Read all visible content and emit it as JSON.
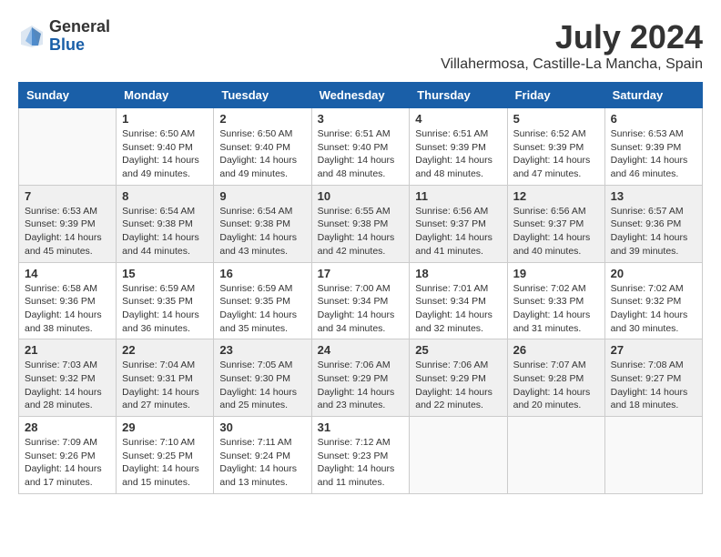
{
  "logo": {
    "general": "General",
    "blue": "Blue"
  },
  "title": "July 2024",
  "location": "Villahermosa, Castille-La Mancha, Spain",
  "days_of_week": [
    "Sunday",
    "Monday",
    "Tuesday",
    "Wednesday",
    "Thursday",
    "Friday",
    "Saturday"
  ],
  "weeks": [
    [
      {
        "day": "",
        "info": ""
      },
      {
        "day": "1",
        "info": "Sunrise: 6:50 AM\nSunset: 9:40 PM\nDaylight: 14 hours\nand 49 minutes."
      },
      {
        "day": "2",
        "info": "Sunrise: 6:50 AM\nSunset: 9:40 PM\nDaylight: 14 hours\nand 49 minutes."
      },
      {
        "day": "3",
        "info": "Sunrise: 6:51 AM\nSunset: 9:40 PM\nDaylight: 14 hours\nand 48 minutes."
      },
      {
        "day": "4",
        "info": "Sunrise: 6:51 AM\nSunset: 9:39 PM\nDaylight: 14 hours\nand 48 minutes."
      },
      {
        "day": "5",
        "info": "Sunrise: 6:52 AM\nSunset: 9:39 PM\nDaylight: 14 hours\nand 47 minutes."
      },
      {
        "day": "6",
        "info": "Sunrise: 6:53 AM\nSunset: 9:39 PM\nDaylight: 14 hours\nand 46 minutes."
      }
    ],
    [
      {
        "day": "7",
        "info": "Sunrise: 6:53 AM\nSunset: 9:39 PM\nDaylight: 14 hours\nand 45 minutes."
      },
      {
        "day": "8",
        "info": "Sunrise: 6:54 AM\nSunset: 9:38 PM\nDaylight: 14 hours\nand 44 minutes."
      },
      {
        "day": "9",
        "info": "Sunrise: 6:54 AM\nSunset: 9:38 PM\nDaylight: 14 hours\nand 43 minutes."
      },
      {
        "day": "10",
        "info": "Sunrise: 6:55 AM\nSunset: 9:38 PM\nDaylight: 14 hours\nand 42 minutes."
      },
      {
        "day": "11",
        "info": "Sunrise: 6:56 AM\nSunset: 9:37 PM\nDaylight: 14 hours\nand 41 minutes."
      },
      {
        "day": "12",
        "info": "Sunrise: 6:56 AM\nSunset: 9:37 PM\nDaylight: 14 hours\nand 40 minutes."
      },
      {
        "day": "13",
        "info": "Sunrise: 6:57 AM\nSunset: 9:36 PM\nDaylight: 14 hours\nand 39 minutes."
      }
    ],
    [
      {
        "day": "14",
        "info": "Sunrise: 6:58 AM\nSunset: 9:36 PM\nDaylight: 14 hours\nand 38 minutes."
      },
      {
        "day": "15",
        "info": "Sunrise: 6:59 AM\nSunset: 9:35 PM\nDaylight: 14 hours\nand 36 minutes."
      },
      {
        "day": "16",
        "info": "Sunrise: 6:59 AM\nSunset: 9:35 PM\nDaylight: 14 hours\nand 35 minutes."
      },
      {
        "day": "17",
        "info": "Sunrise: 7:00 AM\nSunset: 9:34 PM\nDaylight: 14 hours\nand 34 minutes."
      },
      {
        "day": "18",
        "info": "Sunrise: 7:01 AM\nSunset: 9:34 PM\nDaylight: 14 hours\nand 32 minutes."
      },
      {
        "day": "19",
        "info": "Sunrise: 7:02 AM\nSunset: 9:33 PM\nDaylight: 14 hours\nand 31 minutes."
      },
      {
        "day": "20",
        "info": "Sunrise: 7:02 AM\nSunset: 9:32 PM\nDaylight: 14 hours\nand 30 minutes."
      }
    ],
    [
      {
        "day": "21",
        "info": "Sunrise: 7:03 AM\nSunset: 9:32 PM\nDaylight: 14 hours\nand 28 minutes."
      },
      {
        "day": "22",
        "info": "Sunrise: 7:04 AM\nSunset: 9:31 PM\nDaylight: 14 hours\nand 27 minutes."
      },
      {
        "day": "23",
        "info": "Sunrise: 7:05 AM\nSunset: 9:30 PM\nDaylight: 14 hours\nand 25 minutes."
      },
      {
        "day": "24",
        "info": "Sunrise: 7:06 AM\nSunset: 9:29 PM\nDaylight: 14 hours\nand 23 minutes."
      },
      {
        "day": "25",
        "info": "Sunrise: 7:06 AM\nSunset: 9:29 PM\nDaylight: 14 hours\nand 22 minutes."
      },
      {
        "day": "26",
        "info": "Sunrise: 7:07 AM\nSunset: 9:28 PM\nDaylight: 14 hours\nand 20 minutes."
      },
      {
        "day": "27",
        "info": "Sunrise: 7:08 AM\nSunset: 9:27 PM\nDaylight: 14 hours\nand 18 minutes."
      }
    ],
    [
      {
        "day": "28",
        "info": "Sunrise: 7:09 AM\nSunset: 9:26 PM\nDaylight: 14 hours\nand 17 minutes."
      },
      {
        "day": "29",
        "info": "Sunrise: 7:10 AM\nSunset: 9:25 PM\nDaylight: 14 hours\nand 15 minutes."
      },
      {
        "day": "30",
        "info": "Sunrise: 7:11 AM\nSunset: 9:24 PM\nDaylight: 14 hours\nand 13 minutes."
      },
      {
        "day": "31",
        "info": "Sunrise: 7:12 AM\nSunset: 9:23 PM\nDaylight: 14 hours\nand 11 minutes."
      },
      {
        "day": "",
        "info": ""
      },
      {
        "day": "",
        "info": ""
      },
      {
        "day": "",
        "info": ""
      }
    ]
  ]
}
